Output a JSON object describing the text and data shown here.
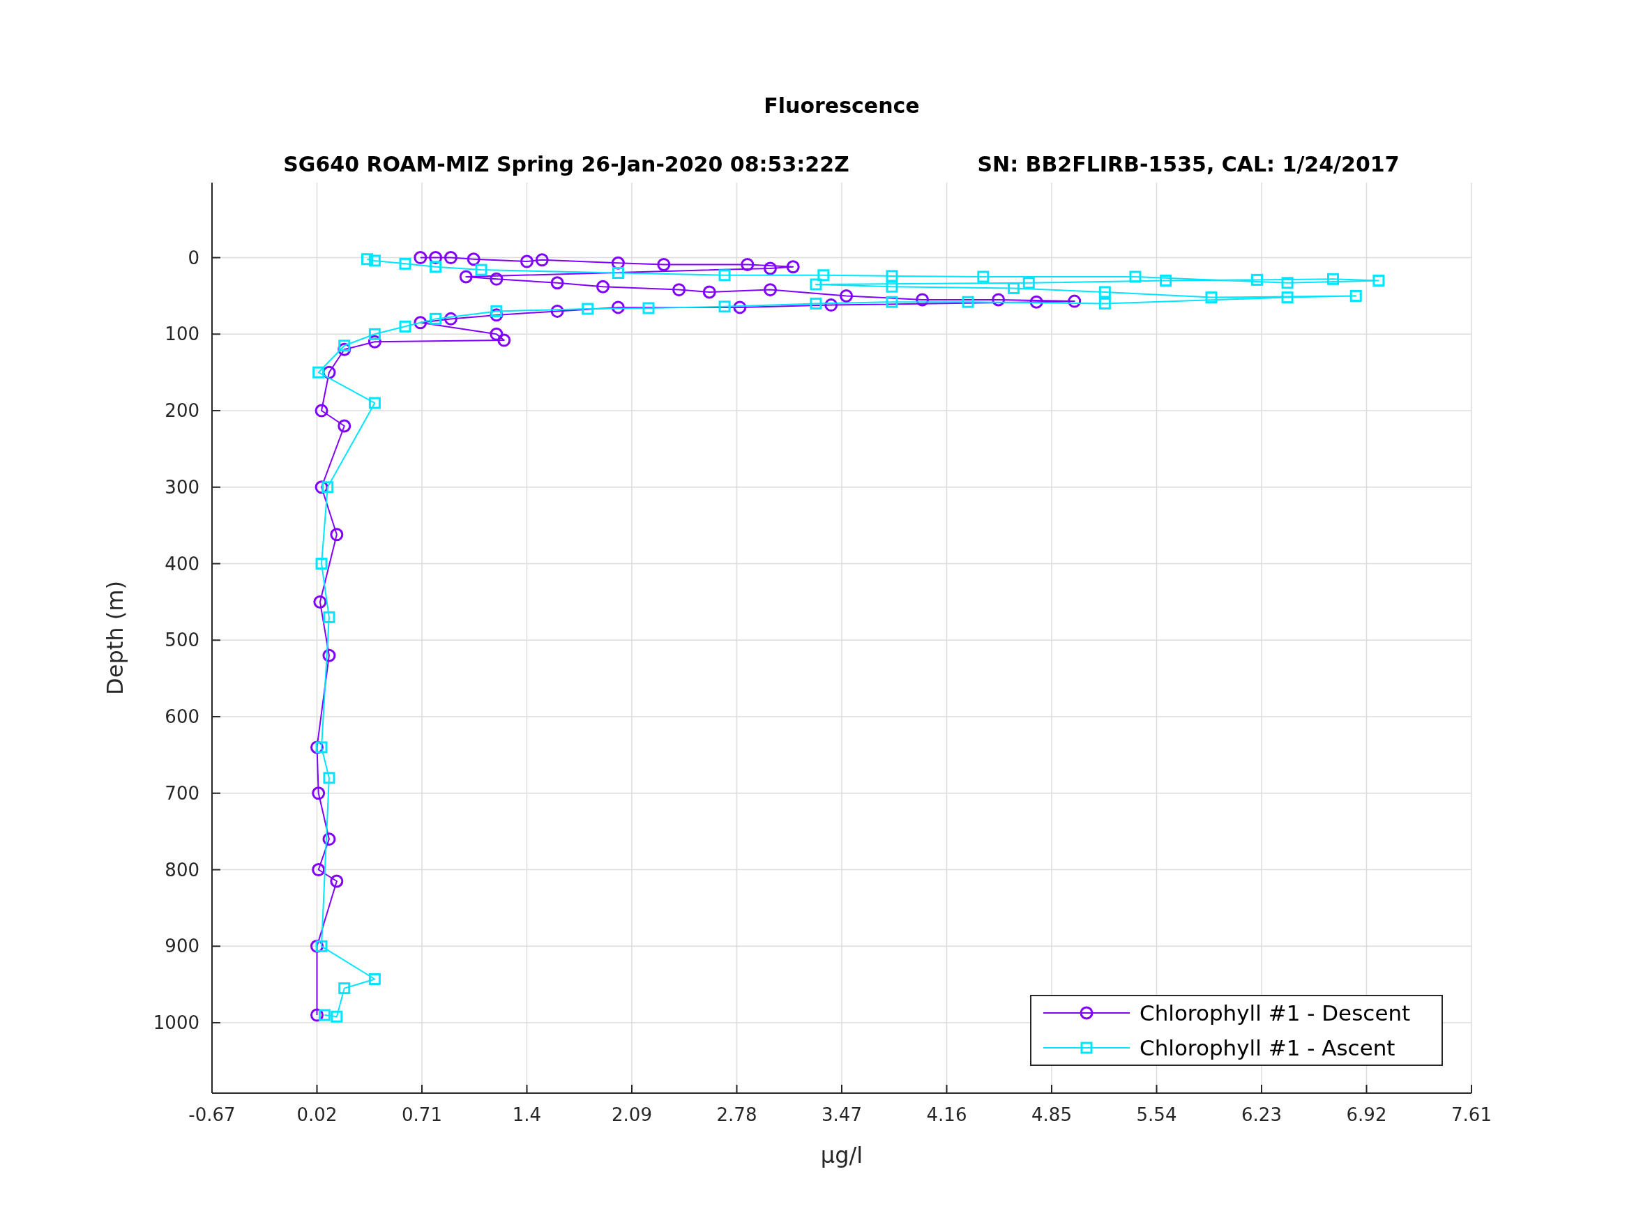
{
  "figure": {
    "title": "Fluorescence",
    "subtitle": [
      "SG640 ROAM-MIZ Spring 26-Jan-2020 08:53:22Z",
      "SN: BB2FLIRB-1535, CAL: 1/24/2017"
    ],
    "chart_data": {
      "type": "line",
      "xlabel": "μg/l",
      "ylabel": "Depth (m)",
      "xlim": [
        -0.67,
        7.61
      ],
      "ylim": [
        1092,
        -98
      ],
      "grid": true,
      "legend": "lower right",
      "xticks": [
        -0.67,
        0.02,
        0.71,
        1.4,
        2.09,
        2.78,
        3.47,
        4.16,
        4.85,
        5.54,
        6.23,
        6.92,
        7.61
      ],
      "yticks": [
        0,
        100,
        200,
        300,
        400,
        500,
        600,
        700,
        800,
        900,
        1000
      ],
      "series": [
        {
          "name": "Chlorophyll #1 - Descent",
          "color": "#8000ff",
          "marker": "circle",
          "x": [
            0.7,
            0.8,
            0.9,
            1.05,
            1.4,
            1.5,
            2.0,
            2.3,
            2.85,
            3.15,
            3.0,
            1.0,
            1.2,
            1.6,
            1.9,
            2.4,
            2.6,
            3.0,
            3.5,
            4.0,
            4.5,
            5.0,
            4.75,
            3.4,
            2.8,
            2.0,
            1.6,
            1.2,
            0.9,
            0.7,
            1.2,
            1.25,
            0.4,
            0.2,
            0.1,
            0.05,
            0.2,
            0.05,
            0.15,
            0.04,
            0.1,
            0.02,
            0.03,
            0.1,
            0.03,
            0.15,
            0.02,
            0.02
          ],
          "values": [
            0,
            0,
            0,
            2,
            5,
            3,
            7,
            9,
            9,
            12,
            14,
            25,
            28,
            33,
            38,
            42,
            45,
            42,
            50,
            55,
            55,
            57,
            58,
            62,
            65,
            65,
            70,
            75,
            80,
            85,
            100,
            108,
            110,
            120,
            150,
            200,
            220,
            300,
            362,
            450,
            520,
            640,
            700,
            760,
            800,
            815,
            900,
            990
          ]
        },
        {
          "name": "Chlorophyll #1 - Ascent",
          "color": "#00e5ff",
          "marker": "square",
          "x": [
            0.07,
            0.15,
            0.2,
            0.4,
            0.05,
            0.1,
            0.05,
            0.1,
            0.05,
            0.09,
            0.4,
            0.03,
            0.2,
            0.4,
            0.6,
            0.8,
            1.2,
            1.8,
            2.2,
            2.7,
            3.3,
            3.8,
            4.3,
            5.2,
            6.4,
            6.85,
            5.9,
            5.2,
            4.6,
            3.8,
            3.3,
            4.7,
            5.6,
            6.2,
            6.7,
            7.0,
            6.4,
            5.4,
            4.4,
            3.8,
            3.35,
            2.7,
            2.0,
            1.1,
            0.8,
            0.6,
            0.4,
            0.35
          ],
          "values": [
            990,
            992,
            955,
            943,
            900,
            680,
            640,
            470,
            400,
            300,
            190,
            150,
            115,
            100,
            90,
            80,
            70,
            67,
            66,
            64,
            60,
            58,
            58,
            60,
            52,
            50,
            52,
            45,
            40,
            38,
            35,
            33,
            30,
            29,
            28,
            30,
            33,
            25,
            25,
            24,
            23,
            23,
            20,
            16,
            12,
            8,
            4,
            2
          ]
        }
      ]
    }
  }
}
